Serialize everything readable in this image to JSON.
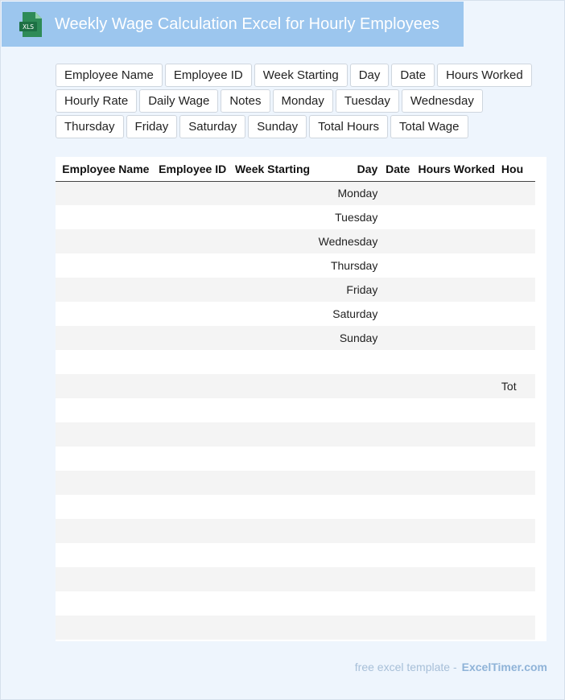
{
  "header": {
    "title": "Weekly Wage Calculation Excel for Hourly Employees",
    "icon_label": "XLS"
  },
  "field_chips": [
    "Employee Name",
    "Employee ID",
    "Week Starting",
    "Day",
    "Date",
    "Hours Worked",
    "Hourly Rate",
    "Daily Wage",
    "Notes",
    "Monday",
    "Tuesday",
    "Wednesday",
    "Thursday",
    "Friday",
    "Saturday",
    "Sunday",
    "Total Hours",
    "Total Wage"
  ],
  "table": {
    "columns": [
      "Employee Name",
      "Employee ID",
      "Week Starting",
      "Day",
      "Date",
      "Hours Worked",
      "Hou"
    ],
    "rows": [
      {
        "idx": "0",
        "day": "Monday",
        "extra": ""
      },
      {
        "idx": "1",
        "day": "Tuesday",
        "extra": ""
      },
      {
        "idx": "2",
        "day": "Wednesday",
        "extra": ""
      },
      {
        "idx": "3",
        "day": "Thursday",
        "extra": ""
      },
      {
        "idx": "4",
        "day": "Friday",
        "extra": ""
      },
      {
        "idx": "5",
        "day": "Saturday",
        "extra": ""
      },
      {
        "idx": "6",
        "day": "Sunday",
        "extra": ""
      },
      {
        "idx": "7",
        "day": "",
        "extra": ""
      },
      {
        "idx": "8",
        "day": "",
        "extra": "Tot"
      },
      {
        "idx": "9",
        "day": "",
        "extra": ""
      },
      {
        "idx": "0",
        "day": "",
        "extra": ""
      },
      {
        "idx": "1",
        "day": "",
        "extra": ""
      },
      {
        "idx": "2",
        "day": "",
        "extra": ""
      },
      {
        "idx": "3",
        "day": "",
        "extra": ""
      },
      {
        "idx": "4",
        "day": "",
        "extra": ""
      },
      {
        "idx": "5",
        "day": "",
        "extra": ""
      },
      {
        "idx": "6",
        "day": "",
        "extra": ""
      },
      {
        "idx": "7",
        "day": "",
        "extra": ""
      },
      {
        "idx": "8",
        "day": "",
        "extra": ""
      }
    ]
  },
  "footer": {
    "lead": "free excel template -",
    "brand": "ExcelTimer.com"
  },
  "colors": {
    "header_bg": "#9cc6ee",
    "page_bg": "#eef5fd",
    "icon_green": "#1d7044",
    "stripe": "#f4f4f4"
  }
}
